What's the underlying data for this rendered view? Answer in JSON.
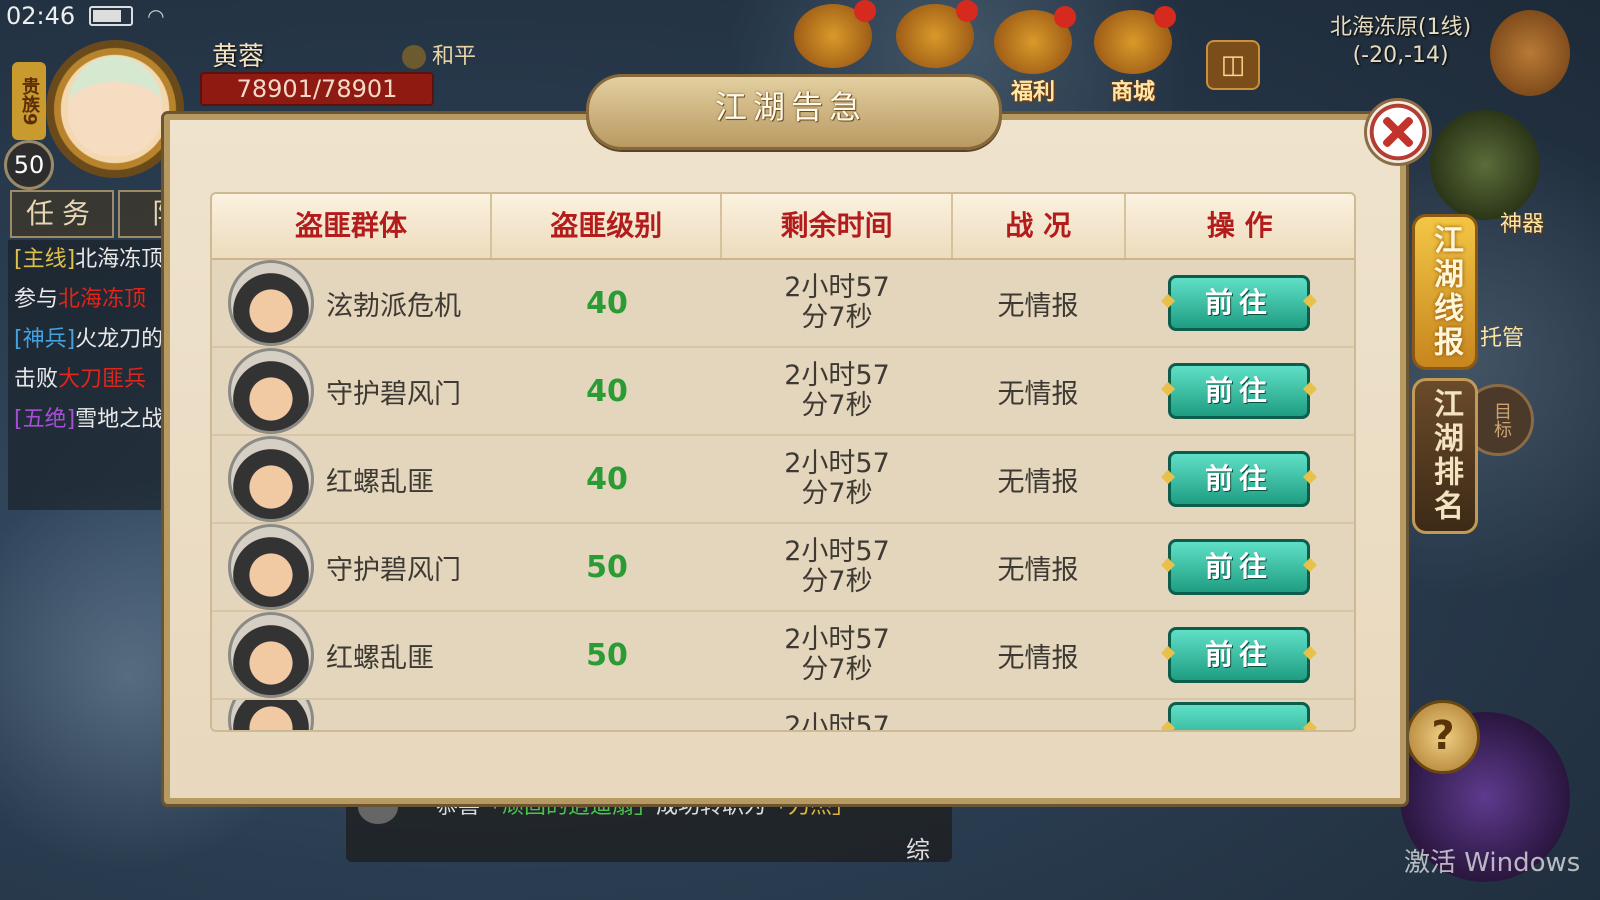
{
  "status": {
    "time": "02:46"
  },
  "player": {
    "name": "黄蓉",
    "hp": "78901/78901",
    "level": "50",
    "noble": "贵族9",
    "pk_mode": "和平"
  },
  "top_icons": [
    {
      "name": "welfare",
      "label": "福利"
    },
    {
      "name": "shop",
      "label": "商城"
    }
  ],
  "map": {
    "name": "北海冻原(1线)",
    "coords": "(-20,-14)"
  },
  "right_panel": {
    "artifact_label": "神器",
    "tab_active": "江湖线报",
    "tab_inactive": "江湖排名",
    "target_label": "目标",
    "aux_label": "托管"
  },
  "task_tabs": [
    "任务",
    "队"
  ],
  "quest_log": [
    {
      "tag": "[主线]",
      "text": "北海冻顶"
    },
    {
      "tag": "",
      "text": "参与",
      "red": "北海冻顶"
    },
    {
      "tag": "[神兵]",
      "text": "火龙刀的"
    },
    {
      "tag": "",
      "text": "击败",
      "red": "大刀匪兵"
    },
    {
      "tag": "[五绝]",
      "text": "雪地之战"
    }
  ],
  "chat": {
    "prefix": "恭喜",
    "name": "「顽固的逍遥扇」",
    "mid": "成功转职为",
    "job": "「刀杰」",
    "channel": "综"
  },
  "watermark": "激活 Windows",
  "modal": {
    "title": "江湖告急",
    "columns": [
      "盗匪群体",
      "盗匪级别",
      "剩余时间",
      "战 况",
      "操 作"
    ],
    "rows": [
      {
        "group": "泫勃派危机",
        "level": "40",
        "time_line1": "2小时57",
        "time_line2": "分7秒",
        "intel": "无情报",
        "action": "前往"
      },
      {
        "group": "守护碧风门",
        "level": "40",
        "time_line1": "2小时57",
        "time_line2": "分7秒",
        "intel": "无情报",
        "action": "前往"
      },
      {
        "group": "红螺乱匪",
        "level": "40",
        "time_line1": "2小时57",
        "time_line2": "分7秒",
        "intel": "无情报",
        "action": "前往"
      },
      {
        "group": "守护碧风门",
        "level": "50",
        "time_line1": "2小时57",
        "time_line2": "分7秒",
        "intel": "无情报",
        "action": "前往"
      },
      {
        "group": "红螺乱匪",
        "level": "50",
        "time_line1": "2小时57",
        "time_line2": "分7秒",
        "intel": "无情报",
        "action": "前往"
      }
    ],
    "partial_row_time": "2小时57"
  }
}
